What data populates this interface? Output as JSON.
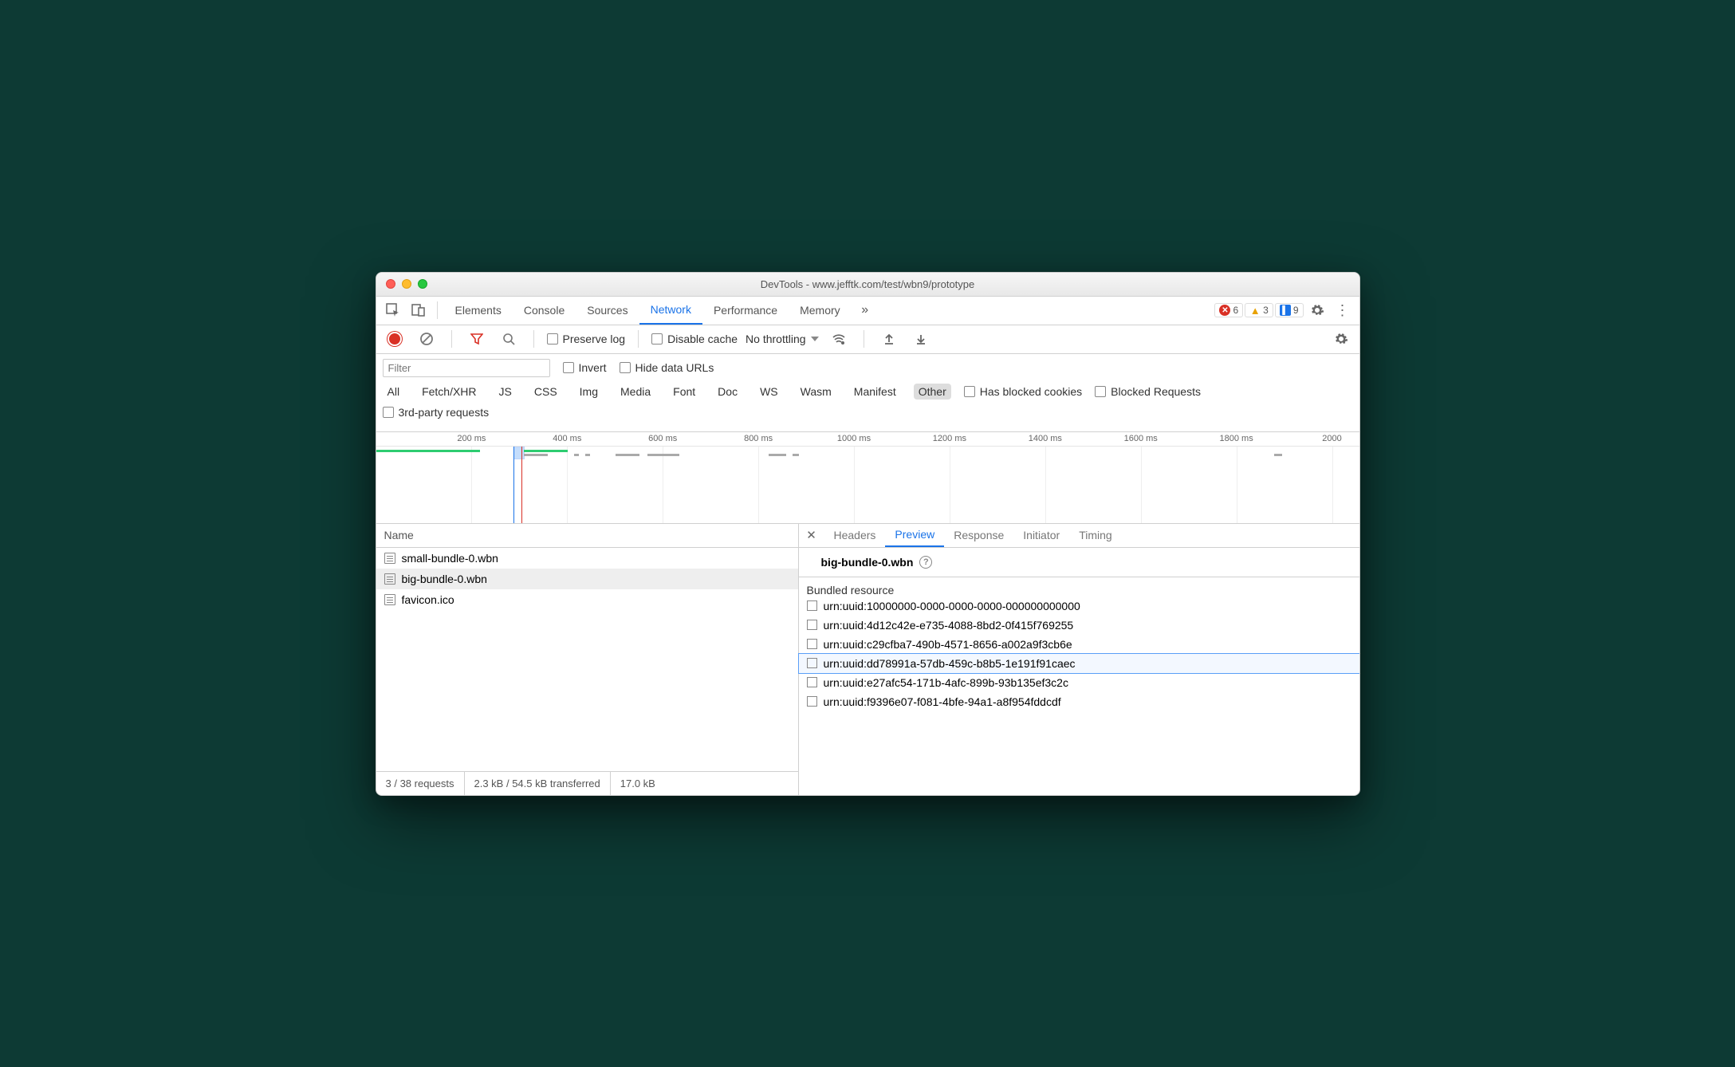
{
  "window": {
    "title": "DevTools - www.jefftk.com/test/wbn9/prototype"
  },
  "main_tabs": {
    "items": [
      "Elements",
      "Console",
      "Sources",
      "Network",
      "Performance",
      "Memory"
    ],
    "active": "Network",
    "overflow_glyph": "»"
  },
  "badges": {
    "error_count": "6",
    "warn_count": "3",
    "msg_count": "9"
  },
  "toolbar": {
    "preserve_log": "Preserve log",
    "disable_cache": "Disable cache",
    "throttle": "No throttling"
  },
  "filter": {
    "placeholder": "Filter",
    "invert": "Invert",
    "hide_data_urls": "Hide data URLs",
    "types": [
      "All",
      "Fetch/XHR",
      "JS",
      "CSS",
      "Img",
      "Media",
      "Font",
      "Doc",
      "WS",
      "Wasm",
      "Manifest",
      "Other"
    ],
    "selected_type": "Other",
    "has_blocked_cookies": "Has blocked cookies",
    "blocked_requests": "Blocked Requests",
    "third_party": "3rd-party requests"
  },
  "timeline": {
    "ticks": [
      "200 ms",
      "400 ms",
      "600 ms",
      "800 ms",
      "1000 ms",
      "1200 ms",
      "1400 ms",
      "1600 ms",
      "1800 ms",
      "2000"
    ]
  },
  "name_column": {
    "header": "Name"
  },
  "requests": [
    {
      "name": "small-bundle-0.wbn",
      "selected": false
    },
    {
      "name": "big-bundle-0.wbn",
      "selected": true
    },
    {
      "name": "favicon.ico",
      "selected": false
    }
  ],
  "status_bar": {
    "requests": "3 / 38 requests",
    "transferred": "2.3 kB / 54.5 kB transferred",
    "resources": "17.0 kB "
  },
  "detail_tabs": {
    "items": [
      "Headers",
      "Preview",
      "Response",
      "Initiator",
      "Timing"
    ],
    "active": "Preview"
  },
  "preview": {
    "title": "big-bundle-0.wbn",
    "section_label": "Bundled resource",
    "resources": [
      "urn:uuid:10000000-0000-0000-0000-000000000000",
      "urn:uuid:4d12c42e-e735-4088-8bd2-0f415f769255",
      "urn:uuid:c29cfba7-490b-4571-8656-a002a9f3cb6e",
      "urn:uuid:dd78991a-57db-459c-b8b5-1e191f91caec",
      "urn:uuid:e27afc54-171b-4afc-899b-93b135ef3c2c",
      "urn:uuid:f9396e07-f081-4bfe-94a1-a8f954fddcdf"
    ],
    "selected_index": 3
  }
}
